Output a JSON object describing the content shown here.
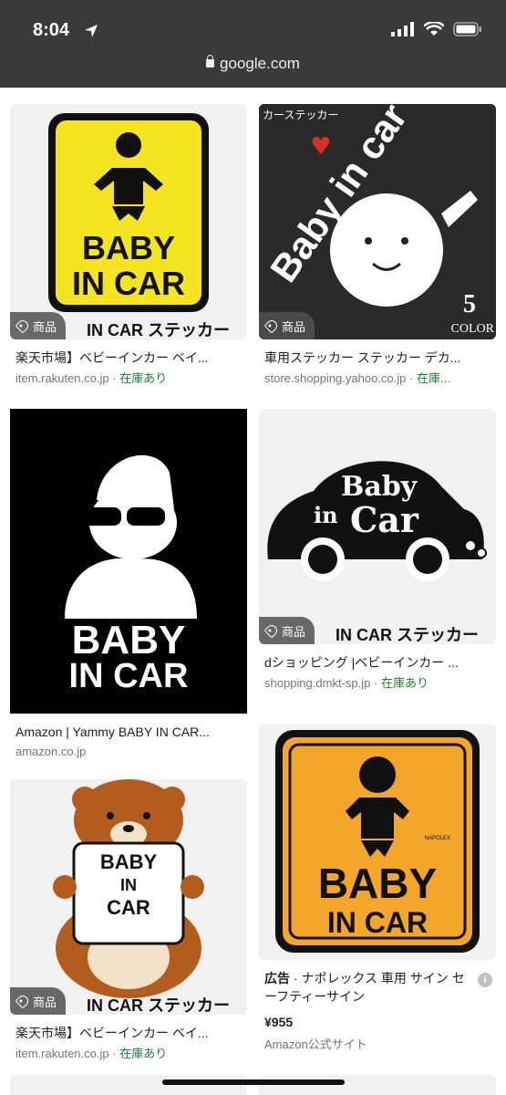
{
  "status": {
    "time": "8:04"
  },
  "url": {
    "domain": "google.com"
  },
  "badge_label": "商品",
  "results": [
    {
      "image_text": [
        "BABY",
        "IN CAR"
      ],
      "overlay_text": "IN CAR ステッカー",
      "title": "楽天市場】ベビーインカー ベイ...",
      "source": "item.rakuten.co.jp",
      "stock": "在庫あり"
    },
    {
      "image_text": [
        "カーステッカー",
        "Baby in car",
        "5",
        "COLOR"
      ],
      "title": "車用ステッカー ステッカー デカ...",
      "source": "store.shopping.yahoo.co.jp",
      "stock": "在庫..."
    },
    {
      "image_text": [
        "BABY",
        "IN CAR"
      ],
      "title": "Amazon | Yammy BABY IN CAR...",
      "source": "amazon.co.jp"
    },
    {
      "image_text": [
        "Baby",
        "in",
        "Car"
      ],
      "overlay_text": "IN CAR ステッカー",
      "title": "dショッピング |ベビーインカー ...",
      "source": "shopping.dmkt-sp.jp",
      "stock": "在庫あり"
    },
    {
      "image_text": [
        "BABY",
        "IN",
        "CAR"
      ],
      "overlay_text": "IN CAR ステッカー",
      "title": "楽天市場】ベビーインカー ベイ...",
      "source": "item.rakuten.co.jp",
      "stock": "在庫あり"
    },
    {
      "image_text": [
        "NAPOLEX",
        "BABY",
        "IN CAR"
      ],
      "ad_label": "広告",
      "ad_text": "ナポレックス 車用 サイン セーフティーサイン",
      "price": "¥955",
      "source": "Amazon公式サイト"
    }
  ],
  "separator": "·"
}
